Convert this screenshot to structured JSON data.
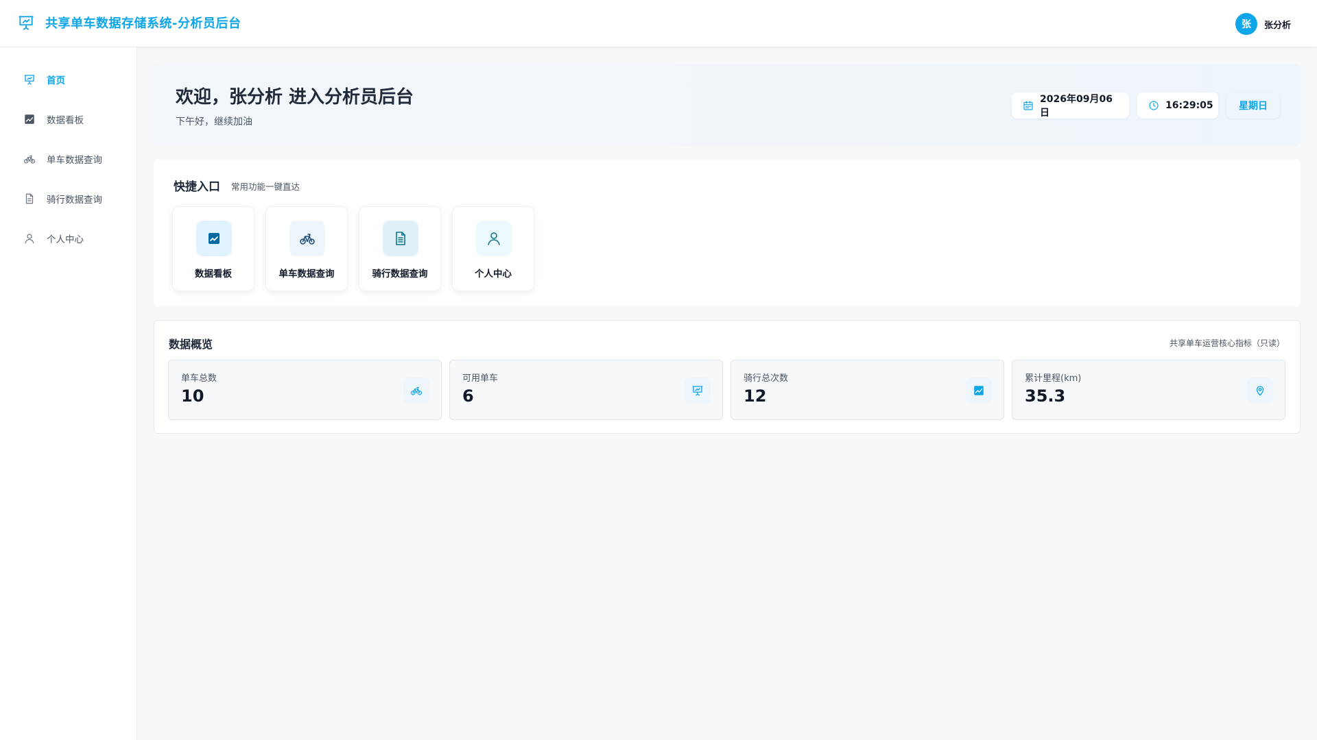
{
  "app": {
    "title": "共享单车数据存储系统-分析员后台",
    "logo_icon": "presentation-chart-icon",
    "accent_color": "#0ea5e9"
  },
  "user": {
    "avatar_text": "张",
    "name": "张分析"
  },
  "sidebar": {
    "items": [
      {
        "label": "首页",
        "icon": "presentation-chart-icon",
        "active": true
      },
      {
        "label": "数据看板",
        "icon": "trend-chart-icon",
        "active": false
      },
      {
        "label": "单车数据查询",
        "icon": "bicycle-icon",
        "active": false
      },
      {
        "label": "骑行数据查询",
        "icon": "document-icon",
        "active": false
      },
      {
        "label": "个人中心",
        "icon": "user-icon",
        "active": false
      }
    ]
  },
  "welcome": {
    "title": "欢迎，张分析 进入分析员后台",
    "subtitle": "下午好，继续加油",
    "date": "2026年09月06日",
    "time": "16:29:05",
    "weekday": "星期日"
  },
  "quick": {
    "title": "快捷入口",
    "subtitle": "常用功能一键直达",
    "items": [
      {
        "label": "数据看板",
        "icon": "trend-chart-icon"
      },
      {
        "label": "单车数据查询",
        "icon": "bicycle-icon"
      },
      {
        "label": "骑行数据查询",
        "icon": "document-icon"
      },
      {
        "label": "个人中心",
        "icon": "user-icon"
      }
    ]
  },
  "overview": {
    "title": "数据概览",
    "note": "共享单车运营核心指标（只读）",
    "stats": [
      {
        "label": "单车总数",
        "value": "10",
        "icon": "bicycle-icon"
      },
      {
        "label": "可用单车",
        "value": "6",
        "icon": "presentation-chart-icon"
      },
      {
        "label": "骑行总次数",
        "value": "12",
        "icon": "trend-chart-icon"
      },
      {
        "label": "累计里程(km)",
        "value": "35.3",
        "icon": "location-pin-icon"
      }
    ]
  }
}
